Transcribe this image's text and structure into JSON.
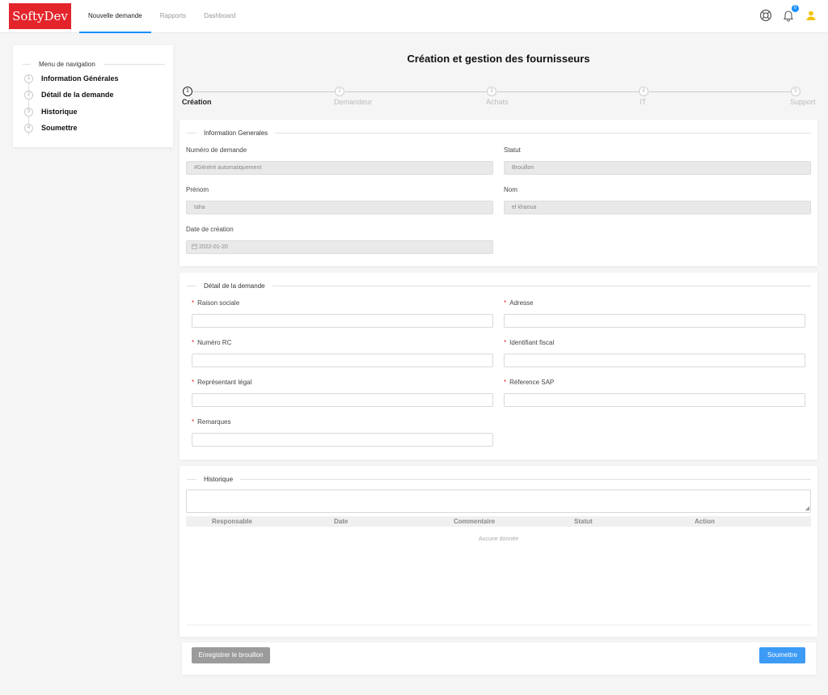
{
  "app": {
    "logo": "SoftyDev"
  },
  "nav": {
    "tabs": [
      "Nouvelle demande",
      "Rapports",
      "Dashboard"
    ],
    "active": 0
  },
  "header": {
    "notification_count": "0",
    "icons": [
      "lifebuoy-icon",
      "bell-icon",
      "user-icon"
    ]
  },
  "left_nav": {
    "title": "Menu de navigation",
    "items": [
      {
        "num": "1",
        "label": "Information Générales"
      },
      {
        "num": "2",
        "label": "Détail de la demande"
      },
      {
        "num": "3",
        "label": "Historique"
      },
      {
        "num": "4",
        "label": "Soumettre"
      }
    ]
  },
  "page": {
    "title": "Création et gestion des fournisseurs"
  },
  "stepper": {
    "steps": [
      {
        "num": "1",
        "label": "Création",
        "active": true
      },
      {
        "num": "2",
        "label": "Demandeur"
      },
      {
        "num": "3",
        "label": "Achats"
      },
      {
        "num": "4",
        "label": "IT"
      },
      {
        "num": "5",
        "label": "Support"
      }
    ]
  },
  "info": {
    "title": "Information Generales",
    "numero_label": "Numéro de demande",
    "numero_value": "#Généré automatiquement",
    "statut_label": "Statut",
    "statut_value": "Brouillon",
    "prenom_label": "Prénom",
    "prenom_value": "taha",
    "nom_label": "Nom",
    "nom_value": "el khaoua",
    "date_label": "Date de création",
    "date_value": "2022-01-20"
  },
  "detail": {
    "title": "Détail de la demande",
    "raison_label": "Raison sociale",
    "adresse_label": "Adresse",
    "rc_label": "Numéro RC",
    "fiscal_label": "Identifiant fiscal",
    "representant_label": "Représentant légal",
    "sap_label": "Réference SAP",
    "remarques_label": "Remarques",
    "required_mark": "*"
  },
  "historique": {
    "title": "Historique",
    "columns": [
      "Responsable",
      "Date",
      "Commentaire",
      "Statut",
      "Action"
    ],
    "empty_text": "Aucune donnée"
  },
  "footer": {
    "draft_label": "Enregistrer le brouillon",
    "submit_label": "Soumettre"
  },
  "colors": {
    "brand": "#e3242b",
    "accent": "#1890ff",
    "submit": "#3d9bf5"
  }
}
